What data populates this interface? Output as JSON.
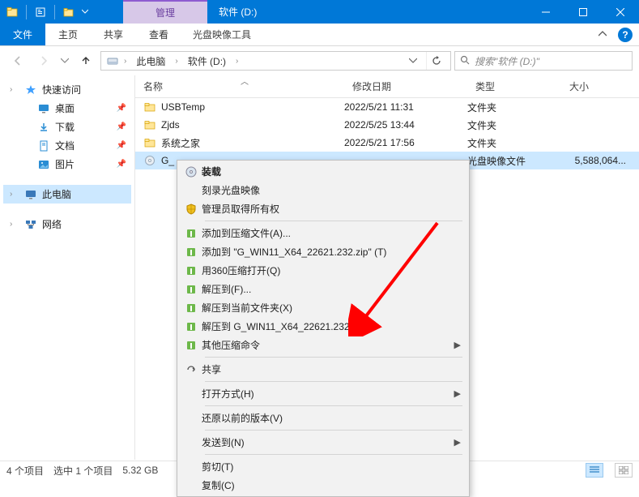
{
  "titlebar": {
    "ctx_manage": "管理",
    "drive_title": "软件 (D:)"
  },
  "ribbon": {
    "file": "文件",
    "home": "主页",
    "share": "共享",
    "view": "查看",
    "tool": "光盘映像工具"
  },
  "address": {
    "this_pc": "此电脑",
    "drive": "软件 (D:)",
    "search_placeholder": "搜索\"软件 (D:)\""
  },
  "sidebar": {
    "quick": "快速访问",
    "desktop": "桌面",
    "downloads": "下载",
    "documents": "文档",
    "pictures": "图片",
    "this_pc": "此电脑",
    "network": "网络"
  },
  "columns": {
    "name": "名称",
    "date": "修改日期",
    "type": "类型",
    "size": "大小"
  },
  "rows": [
    {
      "name": "USBTemp",
      "date": "2022/5/21 11:31",
      "type": "文件夹",
      "size": ""
    },
    {
      "name": "Zjds",
      "date": "2022/5/25 13:44",
      "type": "文件夹",
      "size": ""
    },
    {
      "name": "系统之家",
      "date": "2022/5/21 17:56",
      "type": "文件夹",
      "size": ""
    },
    {
      "name": "G_",
      "date": "",
      "type": "光盘映像文件",
      "size": "5,588,064..."
    }
  ],
  "ctx": {
    "mount": "装载",
    "burn": "刻录光盘映像",
    "admin": "管理员取得所有权",
    "add_archive": "添加到压缩文件(A)...",
    "add_to_zip": "添加到 \"G_WIN11_X64_22621.232.zip\" (T)",
    "open_360": "用360压缩打开(Q)",
    "extract_to": "解压到(F)...",
    "extract_here": "解压到当前文件夹(X)",
    "extract_named": "解压到 G_WIN11_X64_22621.232\\ (E)",
    "other_cmd": "其他压缩命令",
    "share": "共享",
    "open_with": "打开方式(H)",
    "prev_versions": "还原以前的版本(V)",
    "send_to": "发送到(N)",
    "cut": "剪切(T)",
    "copy": "复制(C)"
  },
  "status": {
    "count": "4 个项目",
    "selection": "选中 1 个项目",
    "size": "5.32 GB"
  }
}
